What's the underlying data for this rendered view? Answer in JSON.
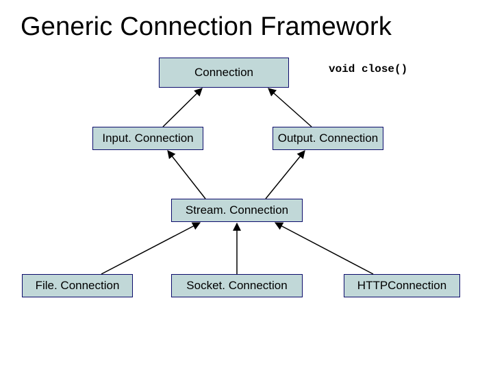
{
  "title": "Generic Connection Framework",
  "annotation": "void close()",
  "nodes": {
    "connection": "Connection",
    "input": "Input. Connection",
    "output": "Output. Connection",
    "stream": "Stream. Connection",
    "file": "File. Connection",
    "socket": "Socket. Connection",
    "http": "HTTPConnection"
  }
}
